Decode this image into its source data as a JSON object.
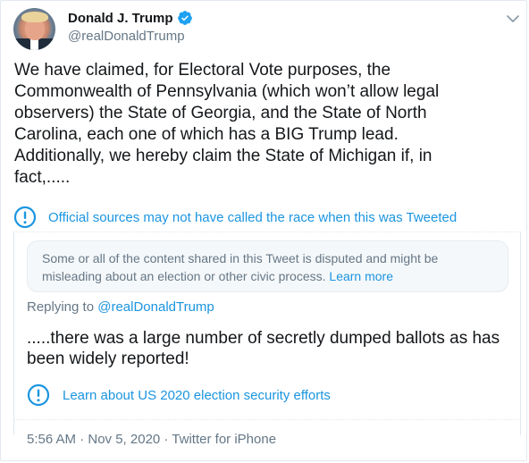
{
  "author": {
    "name": "Donald J. Trump",
    "handle": "@realDonaldTrump"
  },
  "tweet": {
    "text": "We have claimed, for Electoral Vote purposes, the\nCommonwealth of Pennsylvania (which won’t allow legal\nobservers) the State of Georgia, and the State of North\nCarolina, each one of which has a BIG Trump lead.\nAdditionally, we hereby claim the State of Michigan if, in\nfact,.....",
    "notice": "Official sources may not have called the race when this was Tweeted"
  },
  "disputed": {
    "text": "Some or all of the content shared in this Tweet is disputed and might be misleading about an election or other civic process. ",
    "link": "Learn more"
  },
  "reply": {
    "prefix": "Replying to ",
    "mention": "@realDonaldTrump",
    "text": ".....there was a large number of secretly dumped ballots as has been widely reported!",
    "security_link": "Learn about US 2020 election security efforts",
    "meta": "5:56 AM · Nov 5, 2020 · Twitter for iPhone"
  },
  "icons": {
    "verified": "verified-badge-icon",
    "caret": "chevron-down-icon",
    "info": "info-circle-icon"
  },
  "colors": {
    "accent": "#1b95e0",
    "verified": "#1da1f2",
    "secondary_text": "#657786",
    "box_background": "#f5f8fa"
  }
}
